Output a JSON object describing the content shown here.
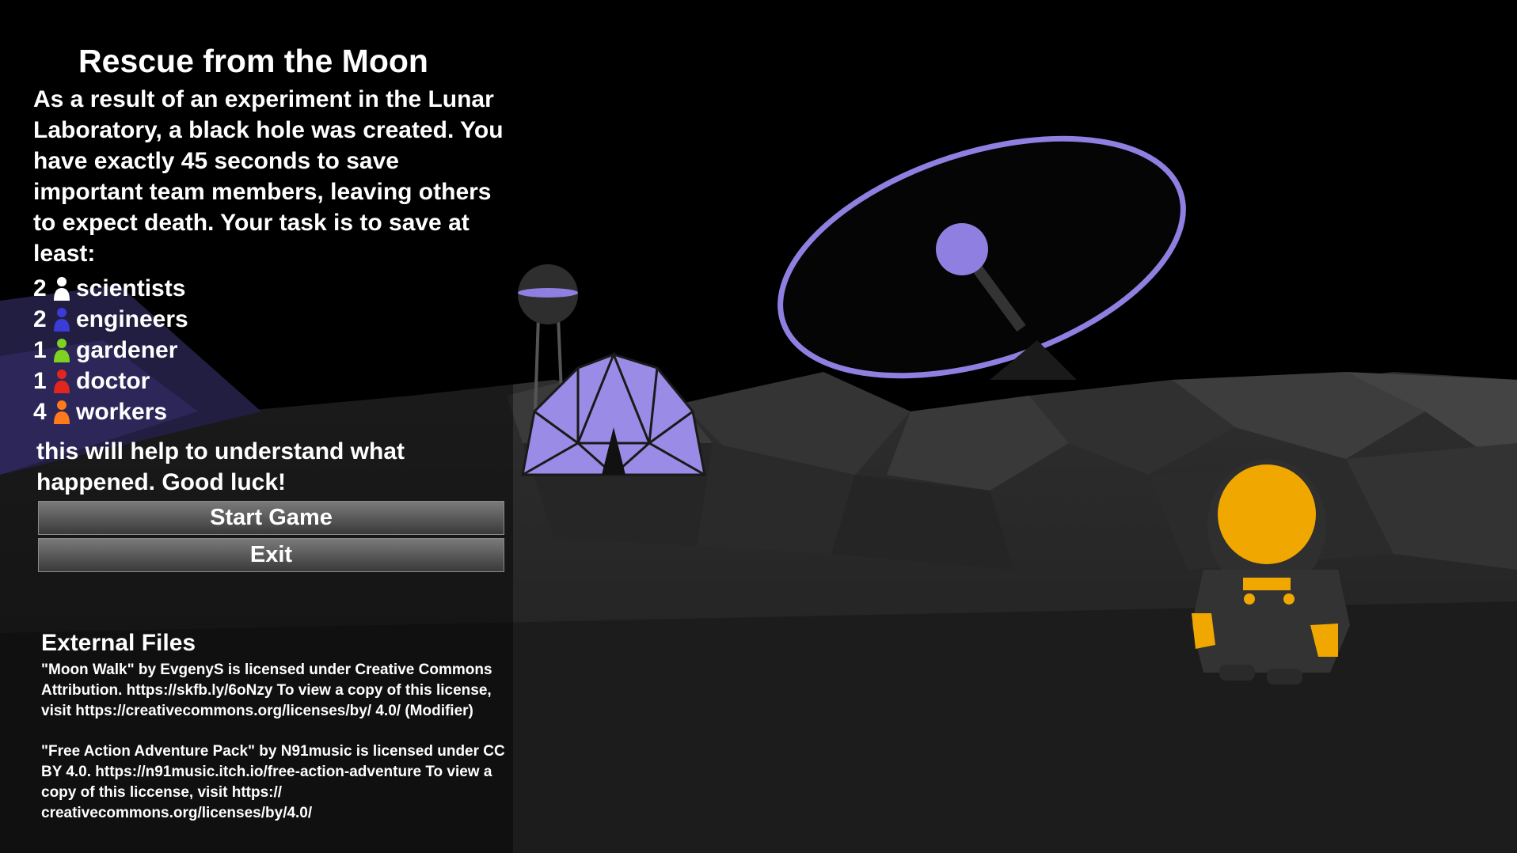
{
  "menu": {
    "title": "Rescue from the Moon",
    "intro": "As a result of an experiment in the Lunar Laboratory, a black hole was created. You have exactly 45 seconds to save important team members, leaving others to expect death. Your task is to save at least:",
    "roles": [
      {
        "count": "2",
        "label": "scientists",
        "color": "#ffffff"
      },
      {
        "count": "2",
        "label": "engineers",
        "color": "#3b3bd6"
      },
      {
        "count": "1",
        "label": "gardener",
        "color": "#7ed321"
      },
      {
        "count": "1",
        "label": "doctor",
        "color": "#e0261e"
      },
      {
        "count": "4",
        "label": "workers",
        "color": "#ff7a1a"
      }
    ],
    "outro": "this will help to understand what happened. Good luck!",
    "start_label": "Start Game",
    "exit_label": "Exit"
  },
  "credits": {
    "title": "External Files",
    "items": [
      "\"Moon Walk\" by EvgenyS is licensed under Creative Commons Attribution. https://skfb.ly/6oNzy To view a copy of this license, visit https://creativecommons.org/licenses/by/ 4.0/  (Modifier)",
      "\"Free Action Adventure Pack\" by N91music is licensed under CC BY 4.0. https://n91music.itch.io/free-action-adventure To view a copy of this liccense, visit https:// creativecommons.org/licenses/by/4.0/"
    ]
  },
  "colors": {
    "accent_purple": "#8f7fe0",
    "visor_orange": "#f0a800"
  }
}
